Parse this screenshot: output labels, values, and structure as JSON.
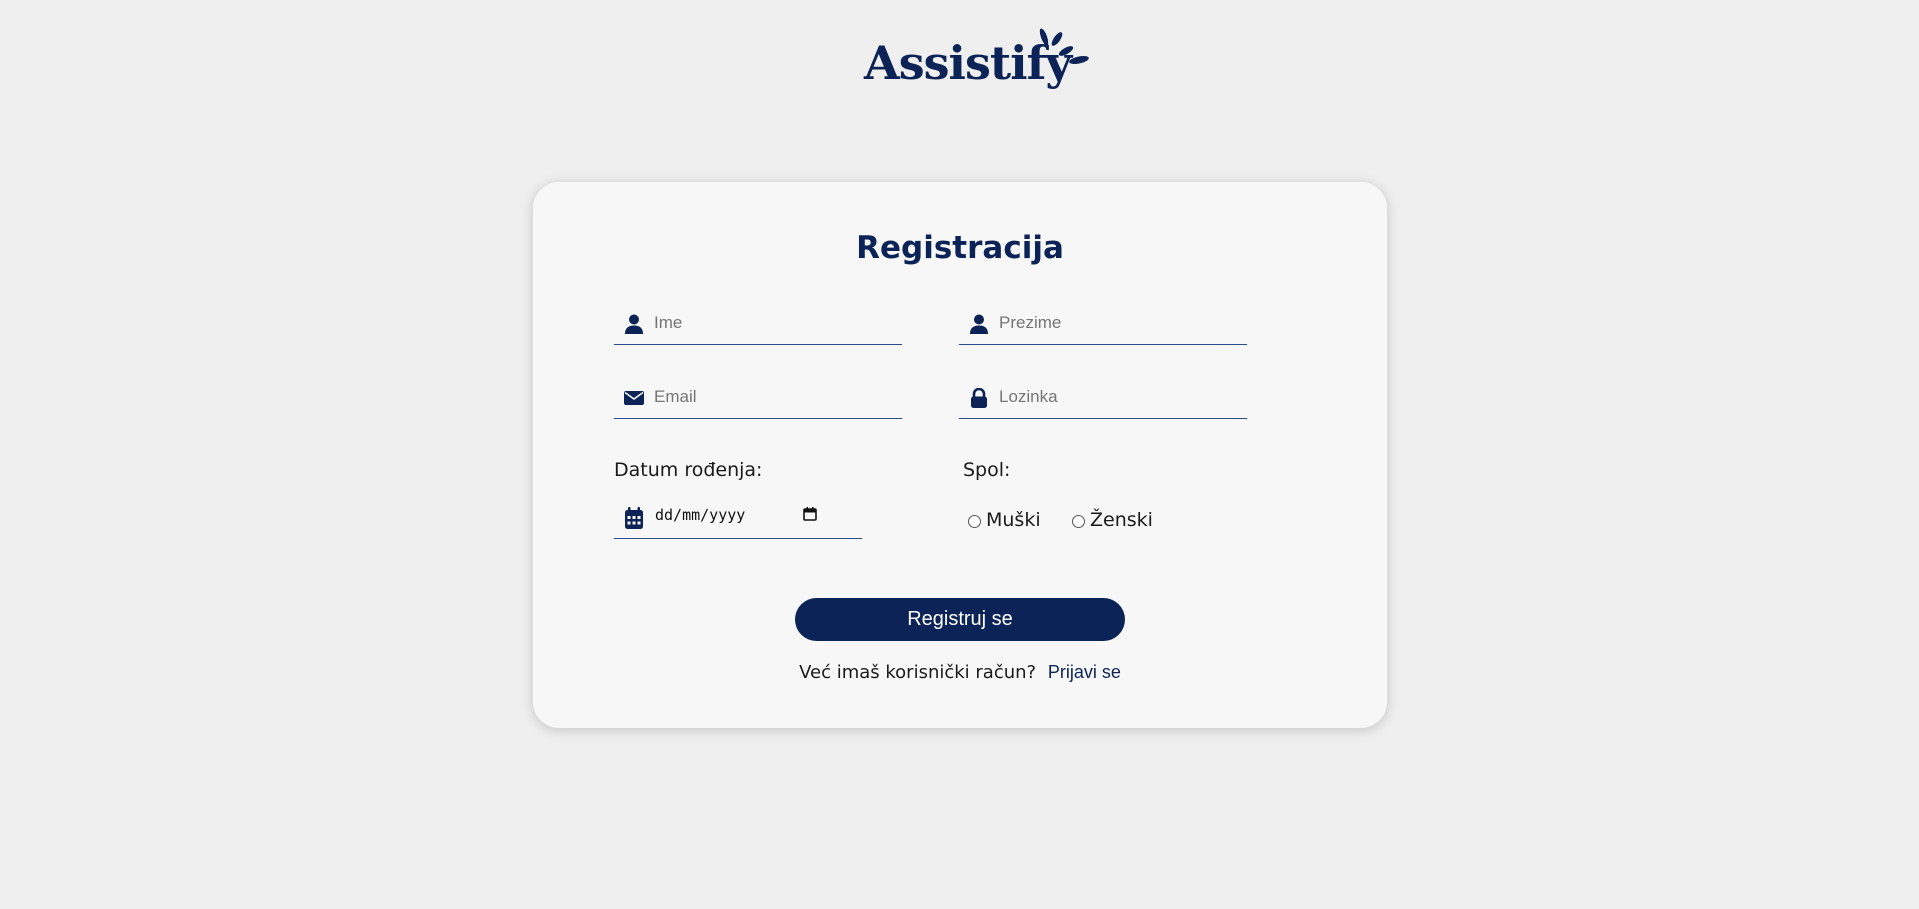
{
  "brand": {
    "logo_text": "Assistify",
    "color": "#0b2357"
  },
  "form": {
    "title": "Registracija",
    "fields": {
      "ime": {
        "placeholder": "Ime",
        "icon": "user-icon"
      },
      "prezime": {
        "placeholder": "Prezime",
        "icon": "user-icon"
      },
      "email": {
        "placeholder": "Email",
        "icon": "envelope-icon"
      },
      "lozinka": {
        "placeholder": "Lozinka",
        "icon": "lock-icon"
      }
    },
    "date": {
      "label": "Datum rođenja:",
      "value": "dd/mm/yyyy",
      "icon": "calendar-icon"
    },
    "gender": {
      "label": "Spol:",
      "options": [
        "Muški",
        "Ženski"
      ]
    },
    "submit_label": "Registruj se",
    "footer": {
      "text": "Već imaš korisnički račun?",
      "link_label": "Prijavi se"
    }
  },
  "colors": {
    "background": "#efefef",
    "card": "#f7f7f7",
    "accent": "#0b2357",
    "underline": "#2d4a8a"
  }
}
